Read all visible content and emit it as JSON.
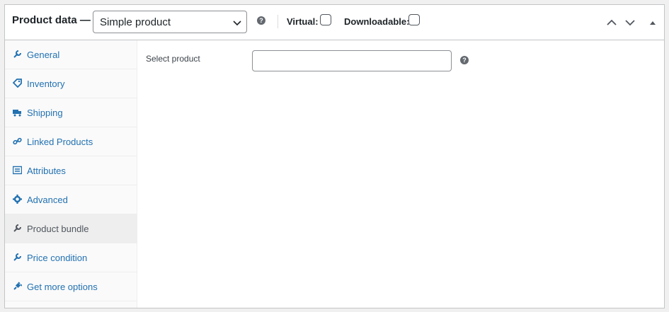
{
  "header": {
    "title": "Product data —",
    "product_type": "Simple product",
    "virtual_label": "Virtual:",
    "downloadable_label": "Downloadable:",
    "virtual_checked": false,
    "downloadable_checked": false,
    "help_glyph": "?"
  },
  "sidebar": {
    "items": [
      {
        "label": "General",
        "icon": "wrench-icon"
      },
      {
        "label": "Inventory",
        "icon": "tag-icon"
      },
      {
        "label": "Shipping",
        "icon": "truck-icon"
      },
      {
        "label": "Linked Products",
        "icon": "link-icon"
      },
      {
        "label": "Attributes",
        "icon": "list-icon"
      },
      {
        "label": "Advanced",
        "icon": "gear-icon"
      },
      {
        "label": "Product bundle",
        "icon": "wrench-icon",
        "active": true
      },
      {
        "label": "Price condition",
        "icon": "wrench-icon"
      },
      {
        "label": "Get more options",
        "icon": "plugin-icon"
      }
    ]
  },
  "main": {
    "select_product_label": "Select product",
    "select_product_value": "",
    "help_glyph": "?"
  },
  "colors": {
    "link": "#2271b1",
    "active_tab_bg": "#eeeeee",
    "border": "#c3c4c7"
  }
}
